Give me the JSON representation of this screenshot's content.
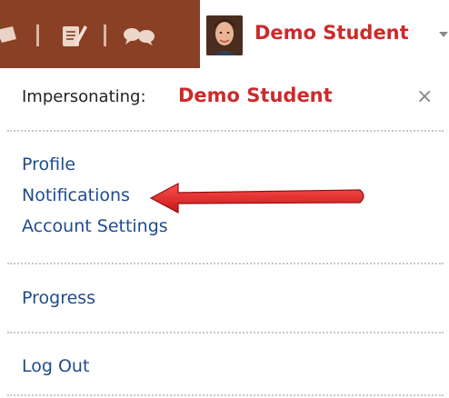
{
  "user_menu": {
    "user_name": "Demo Student",
    "impersonating_label": "Impersonating:",
    "impersonated_name": "Demo Student",
    "close_glyph": "×"
  },
  "menu": {
    "section1": [
      {
        "label": "Profile",
        "name": "menu-profile"
      },
      {
        "label": "Notifications",
        "name": "menu-notifications"
      },
      {
        "label": "Account Settings",
        "name": "menu-account-settings"
      }
    ],
    "progress": "Progress",
    "logout": "Log Out"
  },
  "icons": {
    "nav": [
      "flag-icon",
      "notepad-icon",
      "chat-icon"
    ],
    "annotation": "red-arrow-icon"
  },
  "colors": {
    "nav_brown": "#8a4024",
    "brand_red": "#cc2b2b",
    "link_blue": "#1f4b8e",
    "arrow_red": "#e01b1b"
  }
}
